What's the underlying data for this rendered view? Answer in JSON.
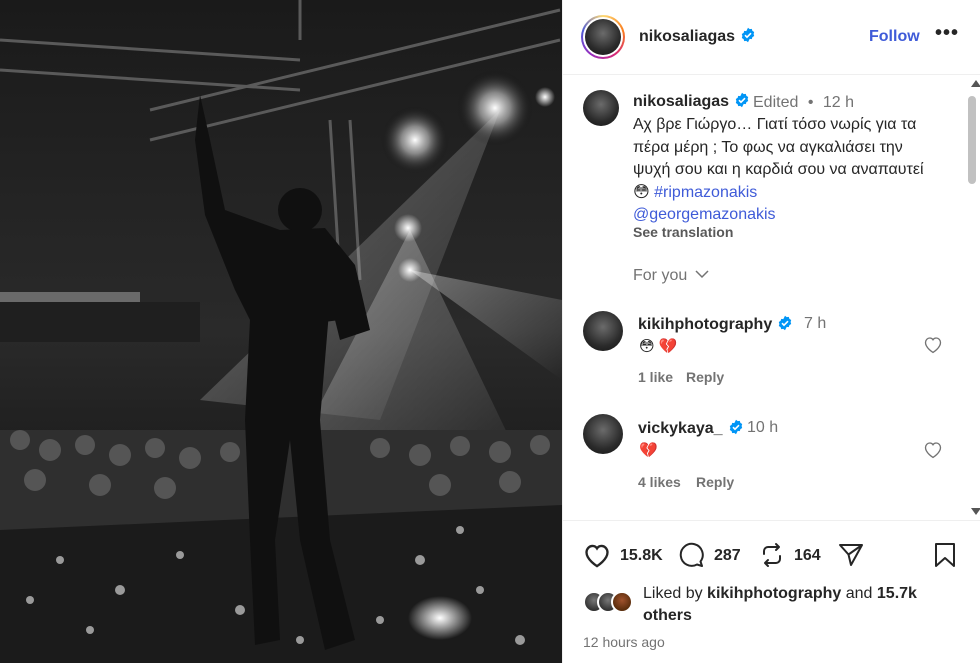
{
  "post": {
    "author": "nikosaliagas",
    "follow_label": "Follow",
    "more_label": "•••",
    "caption": {
      "author": "nikosaliagas",
      "edited": "Edited",
      "dot": "•",
      "time": "12 h",
      "text": "Αχ βρε Γιώργο… Γιατί τόσο νωρίς για τα πέρα μέρη ; Το φως να αγκαλιάσει την ψυχή σου και η καρδιά σου να αναπαυτεί",
      "emoji": "😳",
      "hashtag": "#ripmazonakis",
      "mention": "@georgemazonakis",
      "see_translation": "See translation"
    },
    "for_you_label": "For you"
  },
  "comments": [
    {
      "user": "kikihphotography",
      "time": "7 h",
      "text": "😳 💔",
      "likes": "1 like",
      "reply_label": "Reply"
    },
    {
      "user": "vickykaya_",
      "time": "10 h",
      "text": "💔",
      "likes": "4 likes",
      "reply_label": "Reply"
    }
  ],
  "actions": {
    "likes_count": "15.8K",
    "comments_count": "287",
    "reposts_count": "164"
  },
  "liked_by": {
    "prefix": "Liked by",
    "user": "kikihphotography",
    "and": "and",
    "count": "15.7k",
    "others": "others"
  },
  "timestamp": "12 hours ago",
  "icons": {
    "verified": "verified-badge-icon",
    "heart": "heart-icon",
    "comment": "comment-icon",
    "repost": "repost-icon",
    "share": "share-icon",
    "save": "bookmark-icon",
    "chevron": "chevron-down-icon"
  },
  "colors": {
    "link": "#3f5bd8",
    "verified": "#0095f6",
    "muted": "#737373",
    "text": "#262626"
  }
}
